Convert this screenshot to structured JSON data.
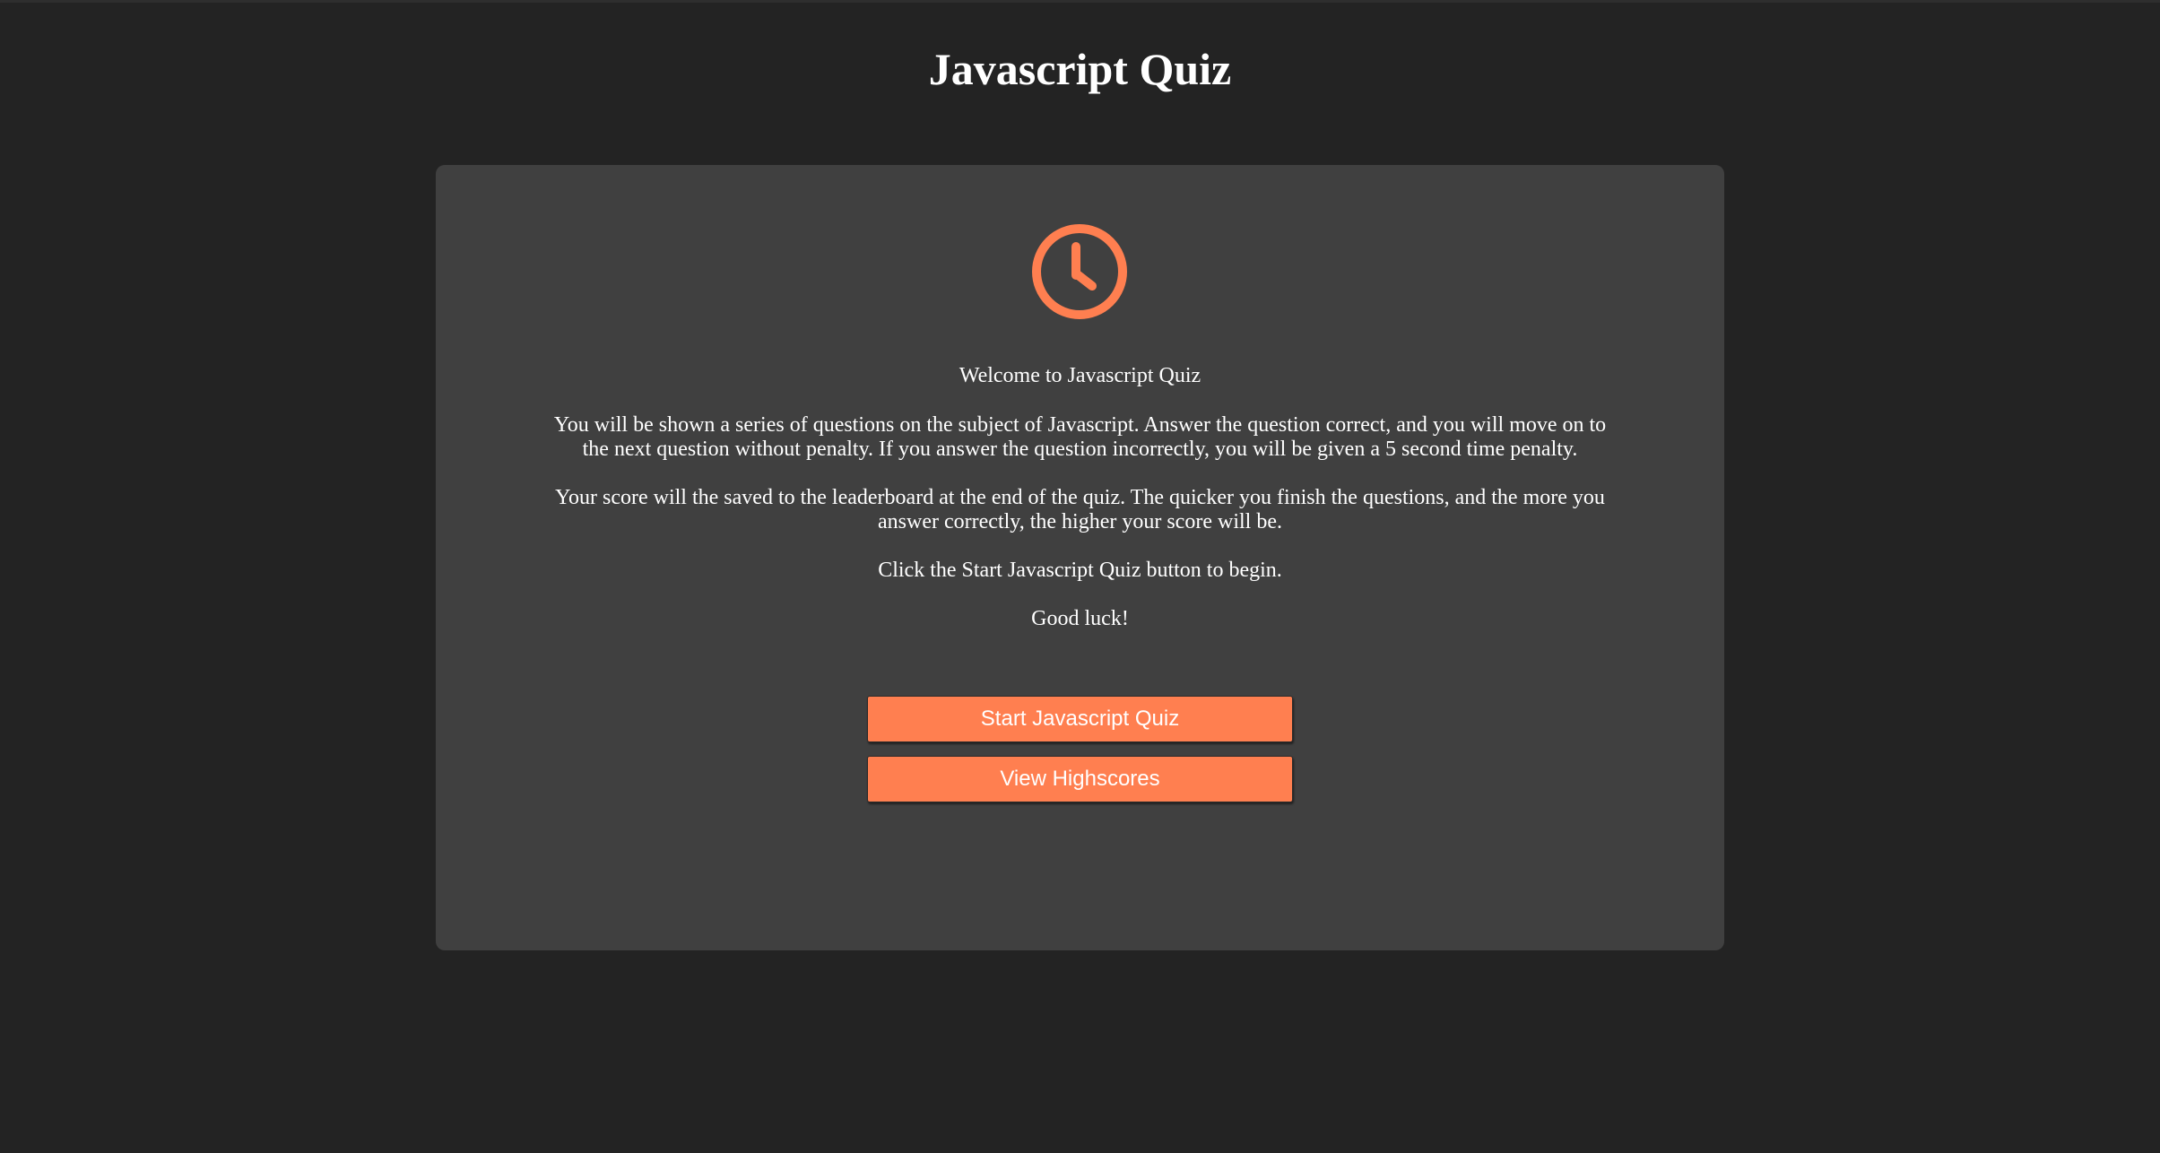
{
  "header": {
    "title": "Javascript Quiz"
  },
  "intro": {
    "icon": "clock-icon",
    "welcome": "Welcome to Javascript Quiz",
    "rules": "You will be shown a series of questions on the subject of Javascript. Answer the question correct, and you will move on to the next question without penalty. If you answer the question incorrectly, you will be given a 5 second time penalty.",
    "scoring": "Your score will the saved to the leaderboard at the end of the quiz. The quicker you finish the questions, and the more you answer correctly, the higher your score will be.",
    "instruction": "Click the Start Javascript Quiz button to begin.",
    "farewell": "Good luck!"
  },
  "actions": {
    "start_label": "Start Javascript Quiz",
    "highscores_label": "View Highscores"
  },
  "colors": {
    "background": "#232323",
    "card": "#404040",
    "accent": "#ff7f50",
    "text": "#ffffff"
  }
}
